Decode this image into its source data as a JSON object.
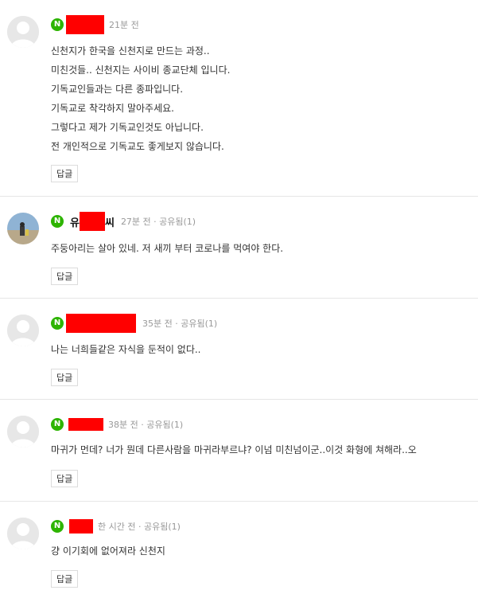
{
  "comments": [
    {
      "badge": "N",
      "time": "21분 전",
      "lines": [
        "신천지가 한국을 신천지로 만드는 과정..",
        "미친것들.. 신천지는 사이비 종교단체 입니다.",
        "기독교인들과는 다른 종파입니다.",
        "기독교로 착각하지 말아주세요.",
        "그렇다고 제가 기독교인것도 아닙니다.",
        "전 개인적으로 기독교도 좋게보지 않습니다."
      ],
      "reply_label": "답글"
    },
    {
      "badge": "N",
      "user_prefix": "유",
      "user_suffix": "씨",
      "time": "27분 전 · 공유됨(1)",
      "lines": [
        "주둥아리는 살아 있네. 저 새끼 부터 코로나를 먹여야 한다."
      ],
      "reply_label": "답글"
    },
    {
      "badge": "N",
      "time": "35분 전 · 공유됨(1)",
      "lines": [
        "나는 너희들같은 자식을 둔적이 없다.."
      ],
      "reply_label": "답글"
    },
    {
      "badge": "N",
      "time": "38분 전 · 공유됨(1)",
      "lines": [
        "마귀가 먼데? 너가 뭔데 다른사람을 마귀라부르냐? 이넘 미친넘이군..이것 화형에 쳐해라..오"
      ],
      "reply_label": "답글"
    },
    {
      "badge": "N",
      "time": "한 시간 전 · 공유됨(1)",
      "lines": [
        "걍 이기회에 없어져라 신천지"
      ],
      "reply_label": "답글"
    }
  ],
  "colors": {
    "naver_badge": "#2db400",
    "redaction": "#ff0000",
    "meta_text": "#999999"
  }
}
